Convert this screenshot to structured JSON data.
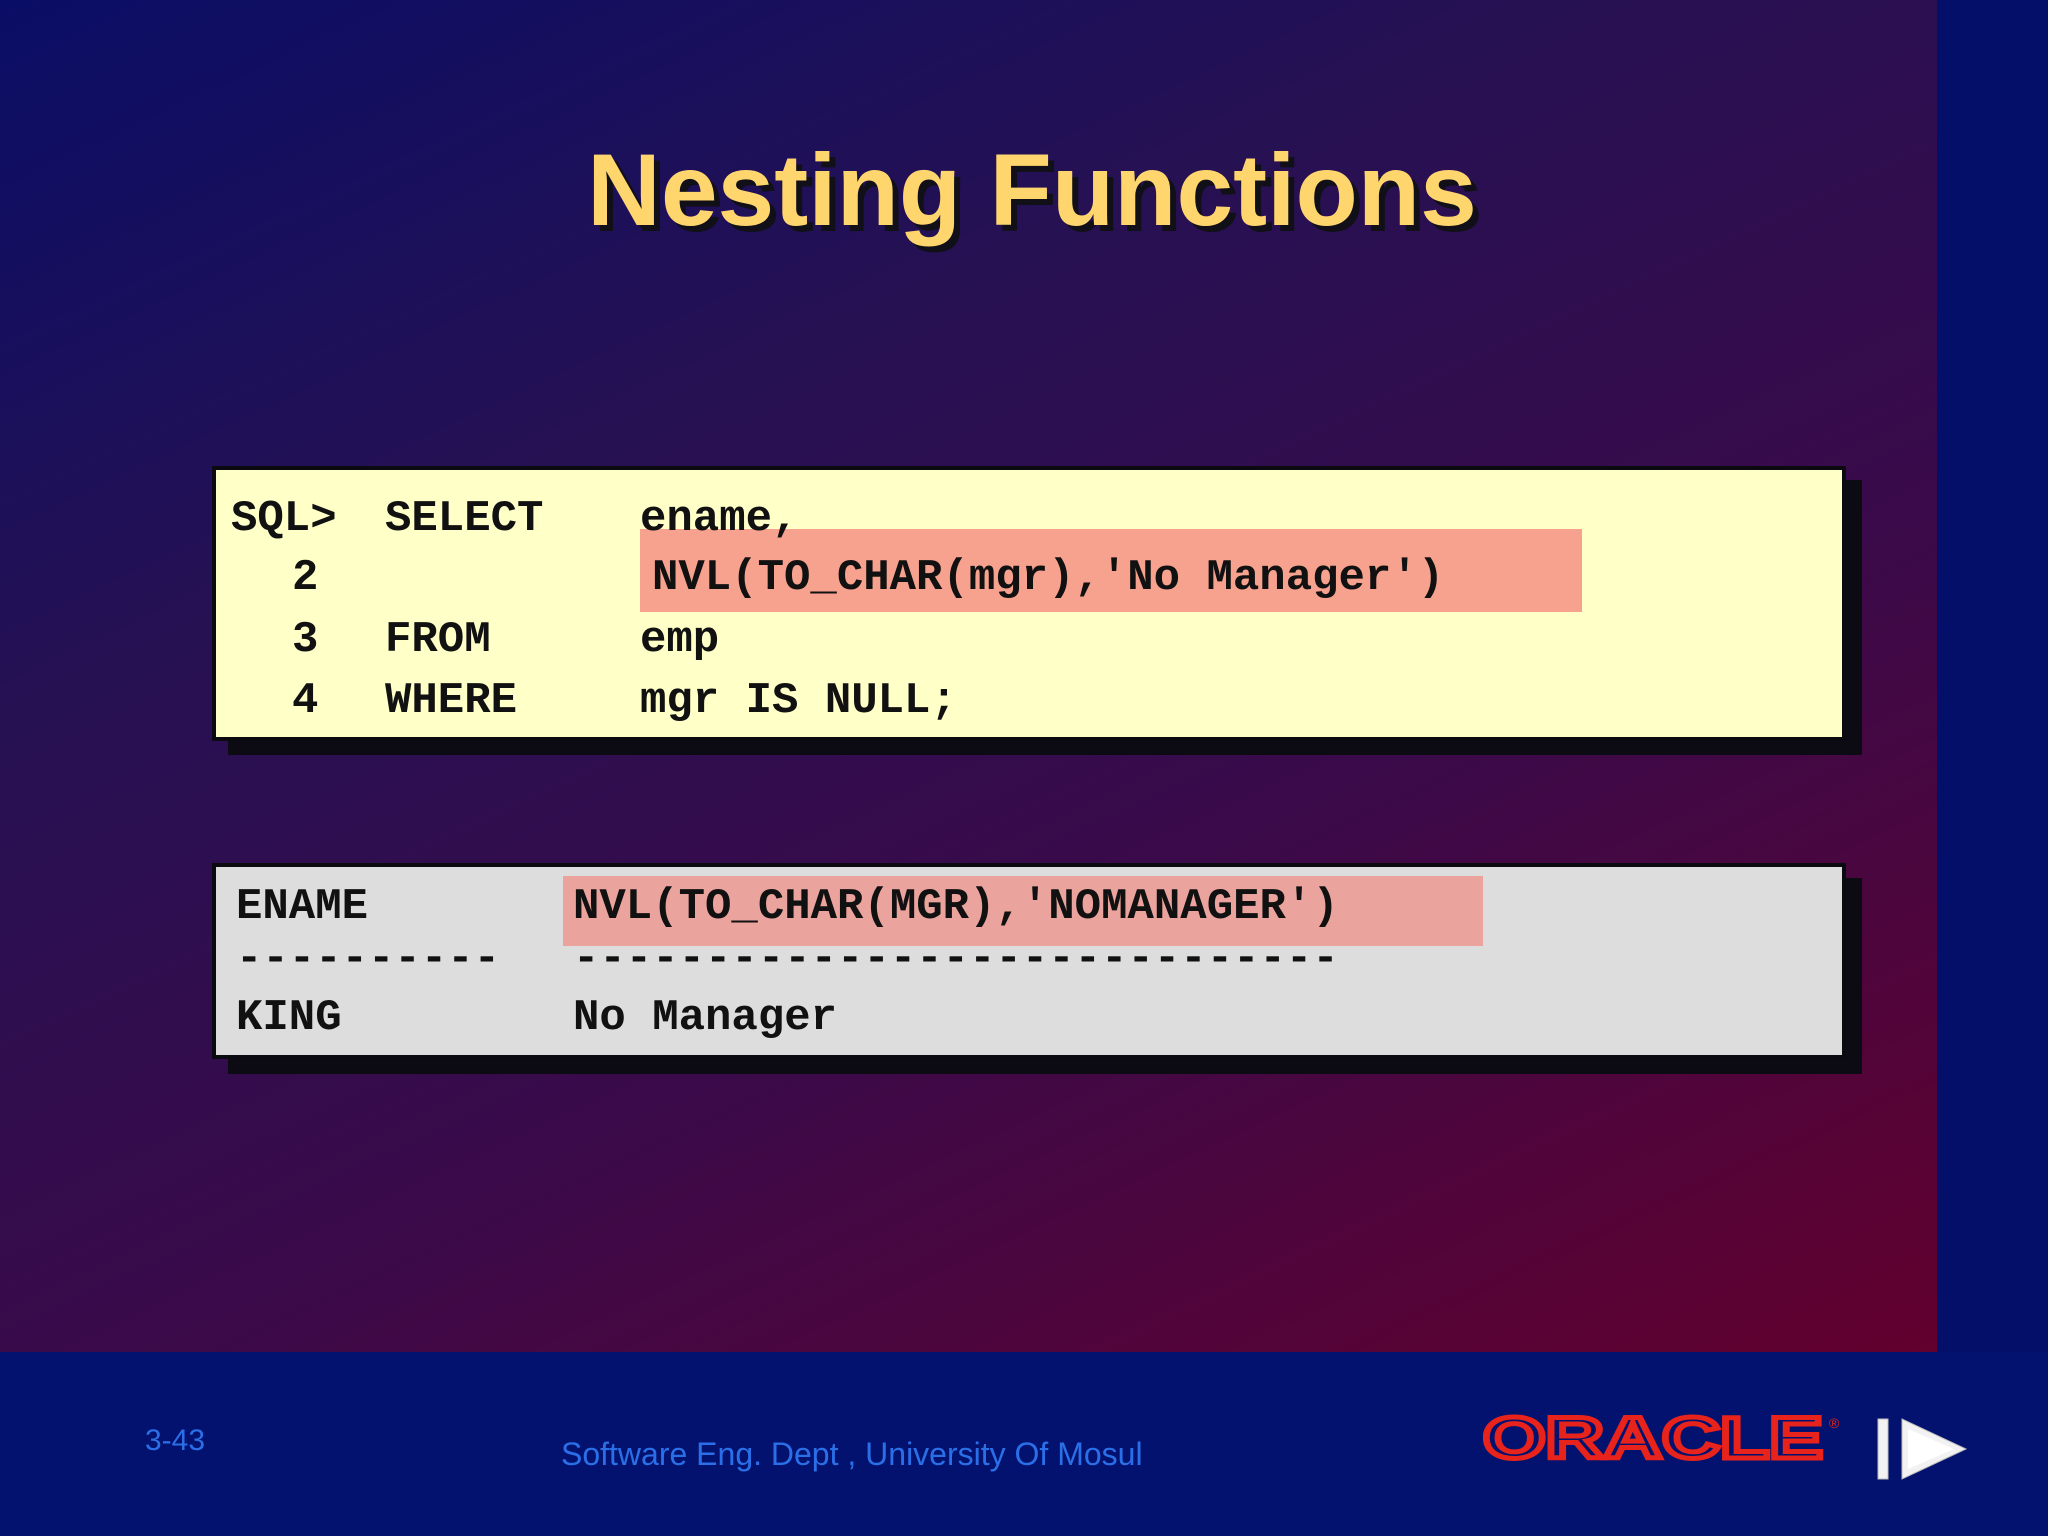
{
  "slide": {
    "title": "Nesting Functions",
    "slide_number": "3-43",
    "footer_text": "Software Eng. Dept , University Of Mosul",
    "logo_text": "ORACLE",
    "logo_registered": "®"
  },
  "code": {
    "lines": [
      {
        "num": "SQL>",
        "keyword": "SELECT",
        "expr": "ename,"
      },
      {
        "num": "2",
        "keyword": "",
        "expr": "NVL(TO_CHAR(mgr),'No Manager')"
      },
      {
        "num": "3",
        "keyword": "FROM",
        "expr": "emp"
      },
      {
        "num": "4",
        "keyword": "WHERE",
        "expr": "mgr IS NULL;"
      }
    ]
  },
  "result": {
    "columns": [
      "ENAME",
      "NVL(TO_CHAR(MGR),'NOMANAGER')"
    ],
    "separators": [
      "----------",
      "-----------------------------"
    ],
    "rows": [
      [
        "KING",
        "No Manager"
      ]
    ]
  },
  "colors": {
    "title": "#ffd56e",
    "code_box": "#ffffc8",
    "result_box": "#dddddd",
    "highlight": "#f7a28e",
    "footer_text": "#2b6fe8",
    "logo": "#e8231c"
  }
}
